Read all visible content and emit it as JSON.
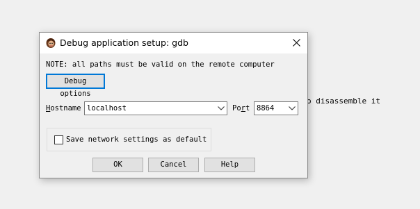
{
  "background": {
    "text": "o disassemble it"
  },
  "dialog": {
    "title": "Debug application setup: gdb",
    "note": "NOTE: all paths must be valid on the remote computer",
    "debug_options_label": "Debug options",
    "hostname": {
      "label_rest": "ostname",
      "label_hotkey": "H",
      "value": "localhost"
    },
    "port": {
      "label_first": "Po",
      "label_hotkey": "r",
      "label_rest": "t",
      "value": "8864"
    },
    "save_checkbox": {
      "label": "Save network settings as default",
      "checked": false
    },
    "buttons": {
      "ok": "OK",
      "cancel": "Cancel",
      "help": "Help"
    }
  },
  "colors": {
    "focus_border": "#0078d7",
    "button_face": "#e1e1e1",
    "dialog_face": "#f0f0f0"
  },
  "icons": [
    "app-icon",
    "close-icon",
    "chevron-down-icon"
  ]
}
